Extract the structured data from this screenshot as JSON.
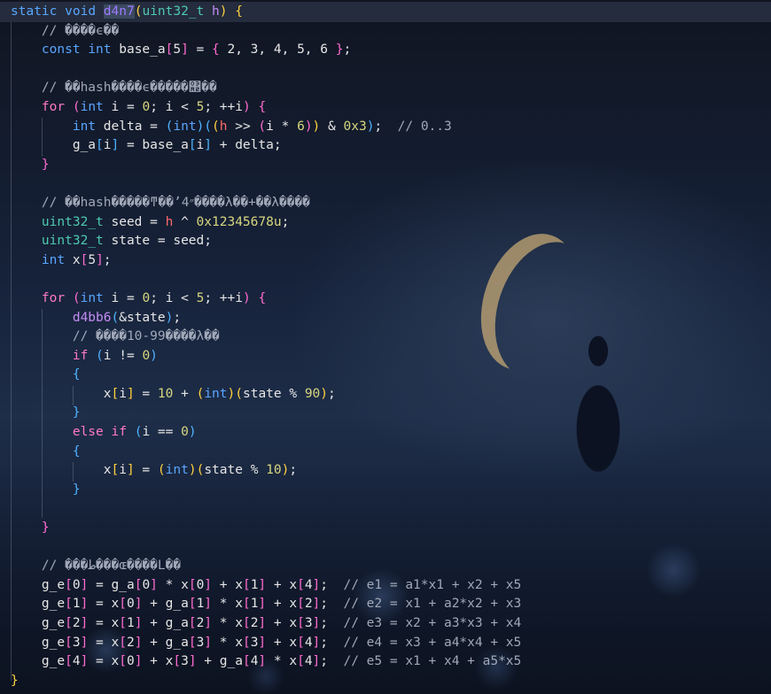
{
  "editor": {
    "lines": [
      [
        {
          "t": "static",
          "c": "kw"
        },
        {
          "t": " ",
          "c": "var"
        },
        {
          "t": "void",
          "c": "kw"
        },
        {
          "t": " ",
          "c": "var"
        },
        {
          "t": "d4n7",
          "c": "fnd"
        },
        {
          "t": "(",
          "c": "p1"
        },
        {
          "t": "uint32_t",
          "c": "ty"
        },
        {
          "t": " h",
          "c": "fn"
        },
        {
          "t": ")",
          "c": "p1"
        },
        {
          "t": " {",
          "c": "p1"
        }
      ],
      [
        {
          "t": "    // ����ϵ��",
          "c": "cm"
        }
      ],
      [
        {
          "t": "    ",
          "c": "var"
        },
        {
          "t": "const",
          "c": "kw"
        },
        {
          "t": " ",
          "c": "var"
        },
        {
          "t": "int",
          "c": "kw"
        },
        {
          "t": " base_a",
          "c": "var"
        },
        {
          "t": "[",
          "c": "p2"
        },
        {
          "t": "5",
          "c": "var"
        },
        {
          "t": "]",
          "c": "p2"
        },
        {
          "t": " = ",
          "c": "var"
        },
        {
          "t": "{",
          "c": "p2"
        },
        {
          "t": " 2, 3, 4, 5, 6 ",
          "c": "var"
        },
        {
          "t": "}",
          "c": "p2"
        },
        {
          "t": ";",
          "c": "var"
        }
      ],
      [
        {
          "t": "",
          "c": "var"
        }
      ],
      [
        {
          "t": "    // ��hash����ϵ�����΢��",
          "c": "cm"
        }
      ],
      [
        {
          "t": "    ",
          "c": "var"
        },
        {
          "t": "for",
          "c": "kw2"
        },
        {
          "t": " ",
          "c": "var"
        },
        {
          "t": "(",
          "c": "p2"
        },
        {
          "t": "int",
          "c": "kw"
        },
        {
          "t": " i = ",
          "c": "var"
        },
        {
          "t": "0",
          "c": "num"
        },
        {
          "t": "; i < ",
          "c": "var"
        },
        {
          "t": "5",
          "c": "num"
        },
        {
          "t": "; ++i",
          "c": "var"
        },
        {
          "t": ")",
          "c": "p2"
        },
        {
          "t": " ",
          "c": "var"
        },
        {
          "t": "{",
          "c": "p2"
        }
      ],
      [
        {
          "t": "        ",
          "c": "var"
        },
        {
          "t": "int",
          "c": "kw"
        },
        {
          "t": " delta = ",
          "c": "var"
        },
        {
          "t": "(",
          "c": "p3"
        },
        {
          "t": "int",
          "c": "kw"
        },
        {
          "t": ")",
          "c": "p3"
        },
        {
          "t": "(",
          "c": "p3"
        },
        {
          "t": "(",
          "c": "p1"
        },
        {
          "t": "h",
          "c": "hx"
        },
        {
          "t": " >> ",
          "c": "var"
        },
        {
          "t": "(",
          "c": "p2"
        },
        {
          "t": "i * ",
          "c": "var"
        },
        {
          "t": "6",
          "c": "num"
        },
        {
          "t": ")",
          "c": "p2"
        },
        {
          "t": ")",
          "c": "p1"
        },
        {
          "t": " & ",
          "c": "var"
        },
        {
          "t": "0x3",
          "c": "num"
        },
        {
          "t": ")",
          "c": "p3"
        },
        {
          "t": ";  ",
          "c": "var"
        },
        {
          "t": "// 0..3",
          "c": "cm"
        }
      ],
      [
        {
          "t": "        g_a",
          "c": "var"
        },
        {
          "t": "[",
          "c": "p3"
        },
        {
          "t": "i",
          "c": "var"
        },
        {
          "t": "]",
          "c": "p3"
        },
        {
          "t": " = base_a",
          "c": "var"
        },
        {
          "t": "[",
          "c": "p3"
        },
        {
          "t": "i",
          "c": "var"
        },
        {
          "t": "]",
          "c": "p3"
        },
        {
          "t": " + delta;",
          "c": "var"
        }
      ],
      [
        {
          "t": "    ",
          "c": "var"
        },
        {
          "t": "}",
          "c": "p2"
        }
      ],
      [
        {
          "t": "",
          "c": "var"
        }
      ],
      [
        {
          "t": "    // ��hash�����ͳ��ʼ״4����λ��+��λ����",
          "c": "cm"
        }
      ],
      [
        {
          "t": "    ",
          "c": "var"
        },
        {
          "t": "uint32_t",
          "c": "ty"
        },
        {
          "t": " seed = ",
          "c": "var"
        },
        {
          "t": "h",
          "c": "hx"
        },
        {
          "t": " ^ ",
          "c": "var"
        },
        {
          "t": "0x12345678u",
          "c": "num"
        },
        {
          "t": ";",
          "c": "var"
        }
      ],
      [
        {
          "t": "    ",
          "c": "var"
        },
        {
          "t": "uint32_t",
          "c": "ty"
        },
        {
          "t": " state = seed;",
          "c": "var"
        }
      ],
      [
        {
          "t": "    ",
          "c": "var"
        },
        {
          "t": "int",
          "c": "kw"
        },
        {
          "t": " x",
          "c": "var"
        },
        {
          "t": "[",
          "c": "p2"
        },
        {
          "t": "5",
          "c": "var"
        },
        {
          "t": "]",
          "c": "p2"
        },
        {
          "t": ";",
          "c": "var"
        }
      ],
      [
        {
          "t": "",
          "c": "var"
        }
      ],
      [
        {
          "t": "    ",
          "c": "var"
        },
        {
          "t": "for",
          "c": "kw2"
        },
        {
          "t": " ",
          "c": "var"
        },
        {
          "t": "(",
          "c": "p2"
        },
        {
          "t": "int",
          "c": "kw"
        },
        {
          "t": " i = ",
          "c": "var"
        },
        {
          "t": "0",
          "c": "num"
        },
        {
          "t": "; i < ",
          "c": "var"
        },
        {
          "t": "5",
          "c": "num"
        },
        {
          "t": "; ++i",
          "c": "var"
        },
        {
          "t": ")",
          "c": "p2"
        },
        {
          "t": " ",
          "c": "var"
        },
        {
          "t": "{",
          "c": "p2"
        }
      ],
      [
        {
          "t": "        ",
          "c": "var"
        },
        {
          "t": "d4bb6",
          "c": "fn"
        },
        {
          "t": "(",
          "c": "p3"
        },
        {
          "t": "&state",
          "c": "var"
        },
        {
          "t": ")",
          "c": "p3"
        },
        {
          "t": ";",
          "c": "var"
        }
      ],
      [
        {
          "t": "        // ����10-99����λ��",
          "c": "cm"
        }
      ],
      [
        {
          "t": "        ",
          "c": "var"
        },
        {
          "t": "if",
          "c": "kw2"
        },
        {
          "t": " ",
          "c": "var"
        },
        {
          "t": "(",
          "c": "p3"
        },
        {
          "t": "i != ",
          "c": "var"
        },
        {
          "t": "0",
          "c": "num"
        },
        {
          "t": ")",
          "c": "p3"
        }
      ],
      [
        {
          "t": "        ",
          "c": "var"
        },
        {
          "t": "{",
          "c": "p3"
        }
      ],
      [
        {
          "t": "            x",
          "c": "var"
        },
        {
          "t": "[",
          "c": "p1"
        },
        {
          "t": "i",
          "c": "var"
        },
        {
          "t": "]",
          "c": "p1"
        },
        {
          "t": " = ",
          "c": "var"
        },
        {
          "t": "10",
          "c": "num"
        },
        {
          "t": " + ",
          "c": "var"
        },
        {
          "t": "(",
          "c": "p1"
        },
        {
          "t": "int",
          "c": "kw"
        },
        {
          "t": ")",
          "c": "p1"
        },
        {
          "t": "(",
          "c": "p1"
        },
        {
          "t": "state % ",
          "c": "var"
        },
        {
          "t": "90",
          "c": "num"
        },
        {
          "t": ")",
          "c": "p1"
        },
        {
          "t": ";",
          "c": "var"
        }
      ],
      [
        {
          "t": "        ",
          "c": "var"
        },
        {
          "t": "}",
          "c": "p3"
        }
      ],
      [
        {
          "t": "        ",
          "c": "var"
        },
        {
          "t": "else",
          "c": "kw2"
        },
        {
          "t": " ",
          "c": "var"
        },
        {
          "t": "if",
          "c": "kw2"
        },
        {
          "t": " ",
          "c": "var"
        },
        {
          "t": "(",
          "c": "p3"
        },
        {
          "t": "i == ",
          "c": "var"
        },
        {
          "t": "0",
          "c": "num"
        },
        {
          "t": ")",
          "c": "p3"
        }
      ],
      [
        {
          "t": "        ",
          "c": "var"
        },
        {
          "t": "{",
          "c": "p3"
        }
      ],
      [
        {
          "t": "            x",
          "c": "var"
        },
        {
          "t": "[",
          "c": "p1"
        },
        {
          "t": "i",
          "c": "var"
        },
        {
          "t": "]",
          "c": "p1"
        },
        {
          "t": " = ",
          "c": "var"
        },
        {
          "t": "(",
          "c": "p1"
        },
        {
          "t": "int",
          "c": "kw"
        },
        {
          "t": ")",
          "c": "p1"
        },
        {
          "t": "(",
          "c": "p1"
        },
        {
          "t": "state % ",
          "c": "var"
        },
        {
          "t": "10",
          "c": "num"
        },
        {
          "t": ")",
          "c": "p1"
        },
        {
          "t": ";",
          "c": "var"
        }
      ],
      [
        {
          "t": "        ",
          "c": "var"
        },
        {
          "t": "}",
          "c": "p3"
        }
      ],
      [
        {
          "t": "",
          "c": "var"
        }
      ],
      [
        {
          "t": "    ",
          "c": "var"
        },
        {
          "t": "}",
          "c": "p2"
        }
      ],
      [
        {
          "t": "",
          "c": "var"
        }
      ],
      [
        {
          "t": "    // ���ط���ɶ����L��",
          "c": "cm"
        }
      ],
      [
        {
          "t": "    g_e",
          "c": "var"
        },
        {
          "t": "[",
          "c": "p2"
        },
        {
          "t": "0",
          "c": "var"
        },
        {
          "t": "]",
          "c": "p2"
        },
        {
          "t": " = g_a",
          "c": "var"
        },
        {
          "t": "[",
          "c": "p2"
        },
        {
          "t": "0",
          "c": "var"
        },
        {
          "t": "]",
          "c": "p2"
        },
        {
          "t": " * x",
          "c": "var"
        },
        {
          "t": "[",
          "c": "p2"
        },
        {
          "t": "0",
          "c": "var"
        },
        {
          "t": "]",
          "c": "p2"
        },
        {
          "t": " + x",
          "c": "var"
        },
        {
          "t": "[",
          "c": "p2"
        },
        {
          "t": "1",
          "c": "var"
        },
        {
          "t": "]",
          "c": "p2"
        },
        {
          "t": " + x",
          "c": "var"
        },
        {
          "t": "[",
          "c": "p2"
        },
        {
          "t": "4",
          "c": "var"
        },
        {
          "t": "]",
          "c": "p2"
        },
        {
          "t": ";  ",
          "c": "var"
        },
        {
          "t": "// e1 = a1*x1 + x2 + x5",
          "c": "cm"
        }
      ],
      [
        {
          "t": "    g_e",
          "c": "var"
        },
        {
          "t": "[",
          "c": "p2"
        },
        {
          "t": "1",
          "c": "var"
        },
        {
          "t": "]",
          "c": "p2"
        },
        {
          "t": " = x",
          "c": "var"
        },
        {
          "t": "[",
          "c": "p2"
        },
        {
          "t": "0",
          "c": "var"
        },
        {
          "t": "]",
          "c": "p2"
        },
        {
          "t": " + g_a",
          "c": "var"
        },
        {
          "t": "[",
          "c": "p2"
        },
        {
          "t": "1",
          "c": "var"
        },
        {
          "t": "]",
          "c": "p2"
        },
        {
          "t": " * x",
          "c": "var"
        },
        {
          "t": "[",
          "c": "p2"
        },
        {
          "t": "1",
          "c": "var"
        },
        {
          "t": "]",
          "c": "p2"
        },
        {
          "t": " + x",
          "c": "var"
        },
        {
          "t": "[",
          "c": "p2"
        },
        {
          "t": "2",
          "c": "var"
        },
        {
          "t": "]",
          "c": "p2"
        },
        {
          "t": ";  ",
          "c": "var"
        },
        {
          "t": "// e2 = x1 + a2*x2 + x3",
          "c": "cm"
        }
      ],
      [
        {
          "t": "    g_e",
          "c": "var"
        },
        {
          "t": "[",
          "c": "p2"
        },
        {
          "t": "2",
          "c": "var"
        },
        {
          "t": "]",
          "c": "p2"
        },
        {
          "t": " = x",
          "c": "var"
        },
        {
          "t": "[",
          "c": "p2"
        },
        {
          "t": "1",
          "c": "var"
        },
        {
          "t": "]",
          "c": "p2"
        },
        {
          "t": " + g_a",
          "c": "var"
        },
        {
          "t": "[",
          "c": "p2"
        },
        {
          "t": "2",
          "c": "var"
        },
        {
          "t": "]",
          "c": "p2"
        },
        {
          "t": " * x",
          "c": "var"
        },
        {
          "t": "[",
          "c": "p2"
        },
        {
          "t": "2",
          "c": "var"
        },
        {
          "t": "]",
          "c": "p2"
        },
        {
          "t": " + x",
          "c": "var"
        },
        {
          "t": "[",
          "c": "p2"
        },
        {
          "t": "3",
          "c": "var"
        },
        {
          "t": "]",
          "c": "p2"
        },
        {
          "t": ";  ",
          "c": "var"
        },
        {
          "t": "// e3 = x2 + a3*x3 + x4",
          "c": "cm"
        }
      ],
      [
        {
          "t": "    g_e",
          "c": "var"
        },
        {
          "t": "[",
          "c": "p2"
        },
        {
          "t": "3",
          "c": "var"
        },
        {
          "t": "]",
          "c": "p2"
        },
        {
          "t": " = x",
          "c": "var"
        },
        {
          "t": "[",
          "c": "p2"
        },
        {
          "t": "2",
          "c": "var"
        },
        {
          "t": "]",
          "c": "p2"
        },
        {
          "t": " + g_a",
          "c": "var"
        },
        {
          "t": "[",
          "c": "p2"
        },
        {
          "t": "3",
          "c": "var"
        },
        {
          "t": "]",
          "c": "p2"
        },
        {
          "t": " * x",
          "c": "var"
        },
        {
          "t": "[",
          "c": "p2"
        },
        {
          "t": "3",
          "c": "var"
        },
        {
          "t": "]",
          "c": "p2"
        },
        {
          "t": " + x",
          "c": "var"
        },
        {
          "t": "[",
          "c": "p2"
        },
        {
          "t": "4",
          "c": "var"
        },
        {
          "t": "]",
          "c": "p2"
        },
        {
          "t": ";  ",
          "c": "var"
        },
        {
          "t": "// e4 = x3 + a4*x4 + x5",
          "c": "cm"
        }
      ],
      [
        {
          "t": "    g_e",
          "c": "var"
        },
        {
          "t": "[",
          "c": "p2"
        },
        {
          "t": "4",
          "c": "var"
        },
        {
          "t": "]",
          "c": "p2"
        },
        {
          "t": " = x",
          "c": "var"
        },
        {
          "t": "[",
          "c": "p2"
        },
        {
          "t": "0",
          "c": "var"
        },
        {
          "t": "]",
          "c": "p2"
        },
        {
          "t": " + x",
          "c": "var"
        },
        {
          "t": "[",
          "c": "p2"
        },
        {
          "t": "3",
          "c": "var"
        },
        {
          "t": "]",
          "c": "p2"
        },
        {
          "t": " + g_a",
          "c": "var"
        },
        {
          "t": "[",
          "c": "p2"
        },
        {
          "t": "4",
          "c": "var"
        },
        {
          "t": "]",
          "c": "p2"
        },
        {
          "t": " * x",
          "c": "var"
        },
        {
          "t": "[",
          "c": "p2"
        },
        {
          "t": "4",
          "c": "var"
        },
        {
          "t": "]",
          "c": "p2"
        },
        {
          "t": ";  ",
          "c": "var"
        },
        {
          "t": "// e5 = x1 + x4 + a5*x5",
          "c": "cm"
        }
      ],
      [
        {
          "t": "}",
          "c": "p1"
        }
      ]
    ]
  }
}
